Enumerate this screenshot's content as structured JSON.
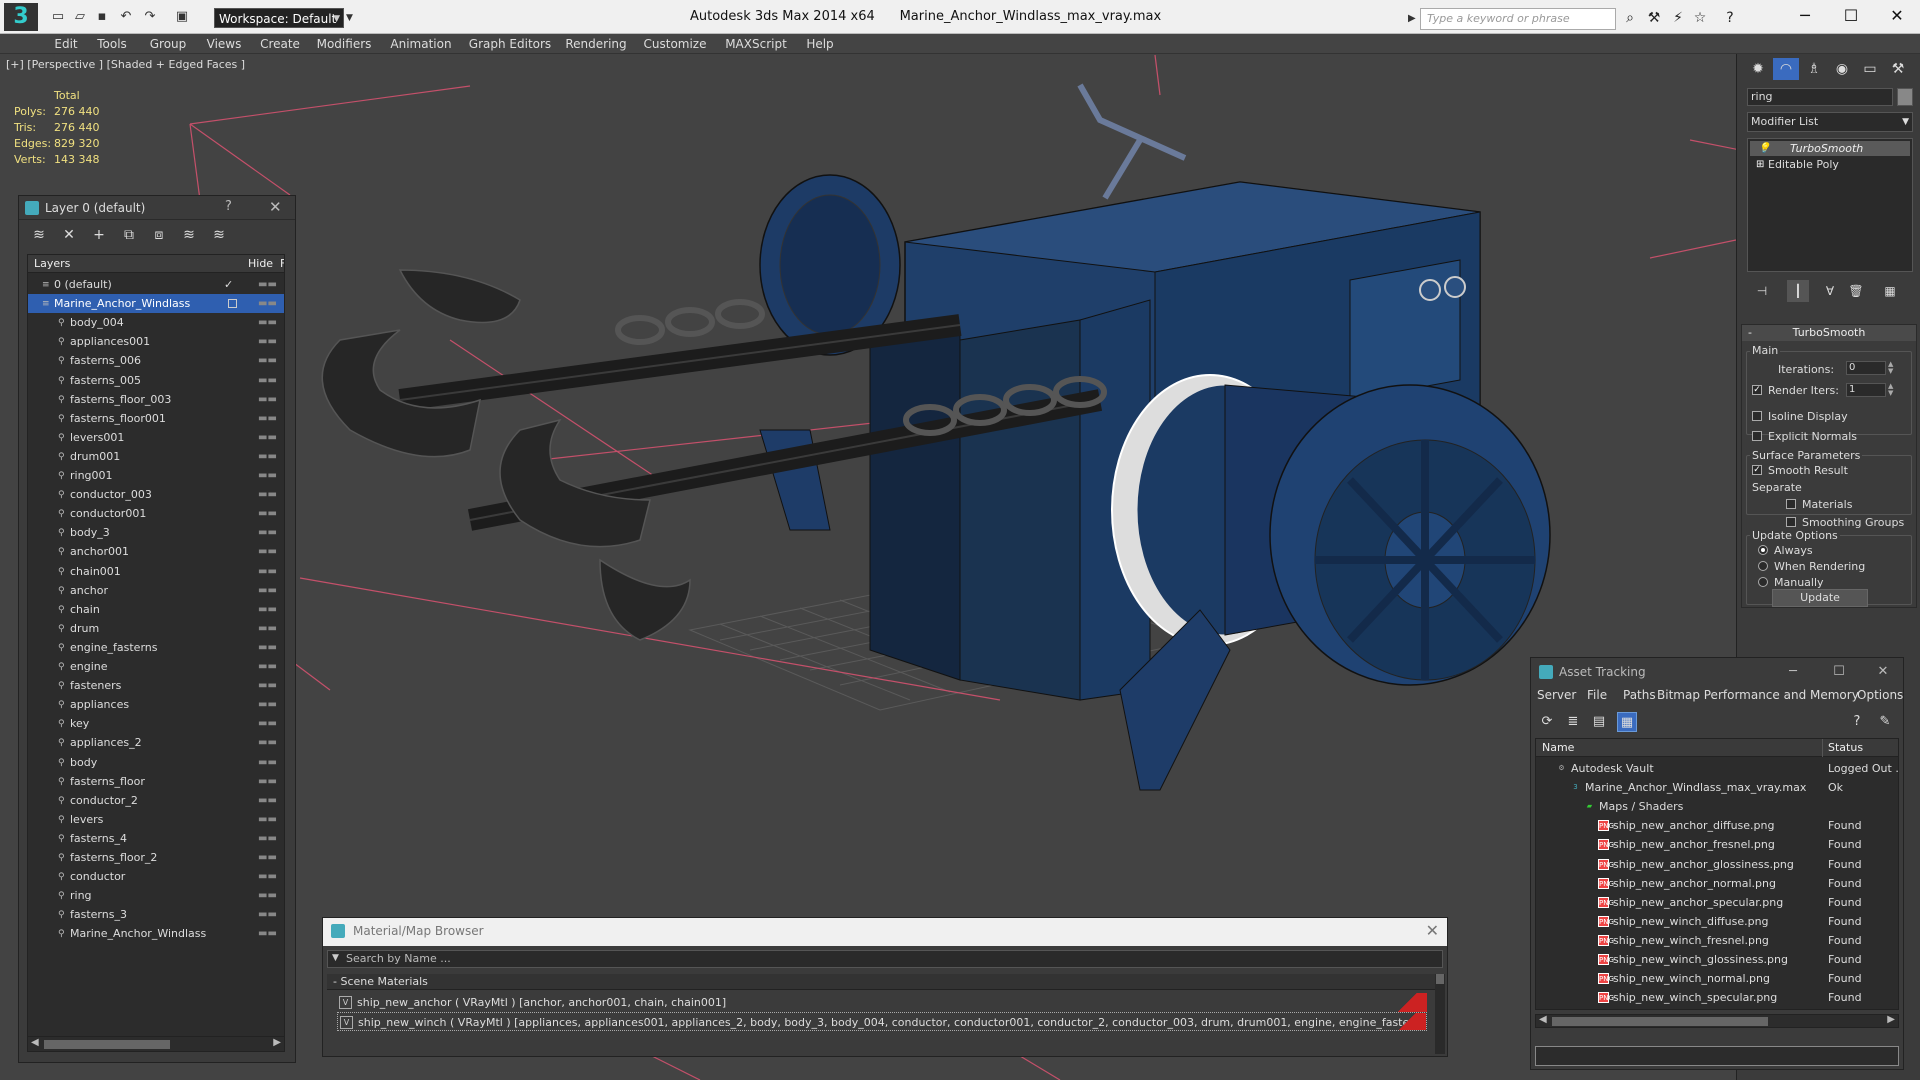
{
  "titlebar": {
    "app_title": "Autodesk 3ds Max  2014 x64",
    "file_title": "Marine_Anchor_Windlass_max_vray.max",
    "workspace": "Workspace: Default",
    "search_placeholder": "Type a keyword or phrase"
  },
  "menu": [
    "Edit",
    "Tools",
    "Group",
    "Views",
    "Create",
    "Modifiers",
    "Animation",
    "Graph Editors",
    "Rendering",
    "Customize",
    "MAXScript",
    "Help"
  ],
  "viewport": {
    "label": "[+] [Perspective ] [Shaded + Edged Faces ]",
    "stats_header": "Total",
    "stats": [
      {
        "k": "Polys:",
        "v": "276 440"
      },
      {
        "k": "Tris:",
        "v": "276 440"
      },
      {
        "k": "Edges:",
        "v": "829 320"
      },
      {
        "k": "Verts:",
        "v": "143 348"
      }
    ]
  },
  "layer_panel": {
    "title": "Layer 0 (default)",
    "help": "?",
    "col_layers": "Layers",
    "col_hide": "Hide",
    "col_f": "F",
    "rows": [
      {
        "name": "0 (default)",
        "level": 0,
        "checked": true
      },
      {
        "name": "Marine_Anchor_Windlass",
        "level": 0,
        "selected": true
      },
      {
        "name": "body_004",
        "level": 1
      },
      {
        "name": "appliances001",
        "level": 1
      },
      {
        "name": "fasterns_006",
        "level": 1
      },
      {
        "name": "fasterns_005",
        "level": 1
      },
      {
        "name": "fasterns_floor_003",
        "level": 1
      },
      {
        "name": "fasterns_floor001",
        "level": 1
      },
      {
        "name": "levers001",
        "level": 1
      },
      {
        "name": "drum001",
        "level": 1
      },
      {
        "name": "ring001",
        "level": 1
      },
      {
        "name": "conductor_003",
        "level": 1
      },
      {
        "name": "conductor001",
        "level": 1
      },
      {
        "name": "body_3",
        "level": 1
      },
      {
        "name": "anchor001",
        "level": 1
      },
      {
        "name": "chain001",
        "level": 1
      },
      {
        "name": "anchor",
        "level": 1
      },
      {
        "name": "chain",
        "level": 1
      },
      {
        "name": "drum",
        "level": 1
      },
      {
        "name": "engine_fasterns",
        "level": 1
      },
      {
        "name": "engine",
        "level": 1
      },
      {
        "name": "fasteners",
        "level": 1
      },
      {
        "name": "appliances",
        "level": 1
      },
      {
        "name": "key",
        "level": 1
      },
      {
        "name": "appliances_2",
        "level": 1
      },
      {
        "name": "body",
        "level": 1
      },
      {
        "name": "fasterns_floor",
        "level": 1
      },
      {
        "name": "conductor_2",
        "level": 1
      },
      {
        "name": "levers",
        "level": 1
      },
      {
        "name": "fasterns_4",
        "level": 1
      },
      {
        "name": "fasterns_floor_2",
        "level": 1
      },
      {
        "name": "conductor",
        "level": 1
      },
      {
        "name": "ring",
        "level": 1
      },
      {
        "name": "fasterns_3",
        "level": 1
      },
      {
        "name": "Marine_Anchor_Windlass",
        "level": 1
      }
    ]
  },
  "command_panel": {
    "object_name": "ring",
    "modifier_list": "Modifier List",
    "stack": [
      {
        "name": "TurboSmooth",
        "selected": true
      },
      {
        "name": "Editable Poly",
        "selected": false
      }
    ],
    "rollout_title": "TurboSmooth",
    "main_group": "Main",
    "iterations_label": "Iterations:",
    "iterations_value": "0",
    "render_iters_label": "Render Iters:",
    "render_iters_value": "1",
    "render_iters_checked": true,
    "isoline_display": "Isoline Display",
    "explicit_normals": "Explicit Normals",
    "surface_group": "Surface Parameters",
    "smooth_result": "Smooth Result",
    "separate_label": "Separate",
    "materials": "Materials",
    "smoothing_groups": "Smoothing Groups",
    "update_group": "Update Options",
    "always": "Always",
    "when_rendering": "When Rendering",
    "manually": "Manually",
    "update_button": "Update"
  },
  "asset_tracking": {
    "title": "Asset Tracking",
    "menu": [
      "Server",
      "File",
      "Paths",
      "Bitmap Performance and Memory",
      "Options"
    ],
    "col_name": "Name",
    "col_status": "Status",
    "rows": [
      {
        "name": "Autodesk Vault",
        "status": "Logged Out ...",
        "level": 0,
        "icon": "vault"
      },
      {
        "name": "Marine_Anchor_Windlass_max_vray.max",
        "status": "Ok",
        "level": 1,
        "icon": "max"
      },
      {
        "name": "Maps / Shaders",
        "status": "",
        "level": 2,
        "icon": "maps"
      },
      {
        "name": "ship_new_anchor_diffuse.png",
        "status": "Found",
        "level": 3,
        "icon": "png"
      },
      {
        "name": "ship_new_anchor_fresnel.png",
        "status": "Found",
        "level": 3,
        "icon": "png"
      },
      {
        "name": "ship_new_anchor_glossiness.png",
        "status": "Found",
        "level": 3,
        "icon": "png"
      },
      {
        "name": "ship_new_anchor_normal.png",
        "status": "Found",
        "level": 3,
        "icon": "png"
      },
      {
        "name": "ship_new_anchor_specular.png",
        "status": "Found",
        "level": 3,
        "icon": "png"
      },
      {
        "name": "ship_new_winch_diffuse.png",
        "status": "Found",
        "level": 3,
        "icon": "png"
      },
      {
        "name": "ship_new_winch_fresnel.png",
        "status": "Found",
        "level": 3,
        "icon": "png"
      },
      {
        "name": "ship_new_winch_glossiness.png",
        "status": "Found",
        "level": 3,
        "icon": "png"
      },
      {
        "name": "ship_new_winch_normal.png",
        "status": "Found",
        "level": 3,
        "icon": "png"
      },
      {
        "name": "ship_new_winch_specular.png",
        "status": "Found",
        "level": 3,
        "icon": "png"
      }
    ]
  },
  "material_browser": {
    "title": "Material/Map Browser",
    "search_placeholder": "Search by Name ...",
    "section": "- Scene Materials",
    "rows": [
      {
        "text": "ship_new_anchor  ( VRayMtl ) [anchor, anchor001, chain, chain001]"
      },
      {
        "text": "ship_new_winch  ( VRayMtl ) [appliances, appliances001, appliances_2, body, body_3, body_004, conductor, conductor001, conductor_2, conductor_003, drum, drum001, engine, engine_fasterns, fasteners, fas..."
      }
    ]
  }
}
